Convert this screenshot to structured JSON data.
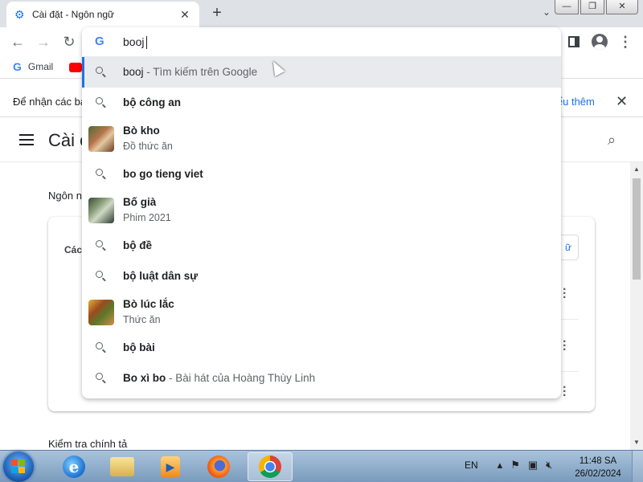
{
  "tab": {
    "title": "Cài đặt - Ngôn ngữ"
  },
  "omnibox": {
    "value": "booj"
  },
  "bookmarks": [
    {
      "label": "Gmail"
    }
  ],
  "infobar": {
    "text": "Để nhận các bả",
    "link": "iểu thêm"
  },
  "settings": {
    "title": "Cài c",
    "section_label": "Ngôn n",
    "card_subtitle": "Các",
    "card_button": "ữ",
    "spellcheck_label": "Kiểm tra chính tả"
  },
  "suggestions": [
    {
      "kind": "search",
      "bold": "booj",
      "dim": " - Tìm kiếm trên Google",
      "selected": true
    },
    {
      "kind": "search",
      "bold": "bộ công an"
    },
    {
      "kind": "entity",
      "bold": "Bò kho",
      "sub": "Đồ thức ăn",
      "thumb": "food"
    },
    {
      "kind": "search",
      "bold": "bo go tieng viet"
    },
    {
      "kind": "entity",
      "bold": "Bố già",
      "sub": "Phim 2021",
      "thumb": "film"
    },
    {
      "kind": "search",
      "bold": "bộ đề"
    },
    {
      "kind": "search",
      "bold": "bộ luật dân sự"
    },
    {
      "kind": "entity",
      "bold": "Bò lúc lắc",
      "sub": "Thức ăn",
      "thumb": "food2"
    },
    {
      "kind": "search",
      "bold": "bộ bài"
    },
    {
      "kind": "search",
      "bold": "Bo xì bo",
      "dim": " - Bài hát của Hoàng Thùy Linh"
    }
  ],
  "taskbar": {
    "language": "EN",
    "time": "11:48 SA",
    "date": "26/02/2024"
  },
  "colors": {
    "accent": "#1a73e8",
    "selected_row": "#e8eaed"
  }
}
